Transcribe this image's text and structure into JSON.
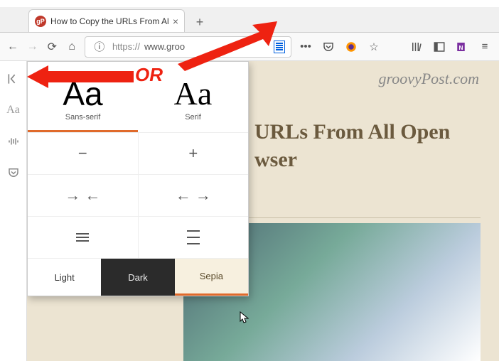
{
  "tab": {
    "title": "How to Copy the URLs From Al",
    "favicon_text": "gP"
  },
  "url": {
    "prefix": "https://",
    "host": "www.groo"
  },
  "toolbar_icons": {
    "back": "←",
    "forward": "→",
    "reload": "⟳",
    "home": "⌂",
    "info": "ⓘ",
    "more": "•••",
    "pocket": "◒",
    "firefox": "🦊",
    "star": "☆",
    "library": "⏐⏐⏐⏐",
    "sidebar": "▥",
    "menu": "≡"
  },
  "sidebar": {
    "close": "⇤",
    "font": "Aa",
    "narrate": "⦀⦀⦀",
    "pocket": "◒"
  },
  "page": {
    "brand": "groovyPost.com",
    "headline_l1": "URLs From All Open",
    "headline_l2": "wser"
  },
  "popover": {
    "fonts": [
      {
        "sample": "Aa",
        "label": "Sans-serif",
        "class": "sans",
        "selected": true
      },
      {
        "sample": "Aa",
        "label": "Serif",
        "class": "serif",
        "selected": false
      }
    ],
    "size": {
      "decrease": "−",
      "increase": "+"
    },
    "width": {
      "narrow_l": "→",
      "narrow_r": "←",
      "wide_l": "←",
      "wide_r": "→"
    },
    "lineheight": {
      "tight": "≡",
      "loose": "≡"
    },
    "themes": {
      "light": "Light",
      "dark": "Dark",
      "sepia": "Sepia"
    }
  },
  "annotation": {
    "or": "OR"
  }
}
